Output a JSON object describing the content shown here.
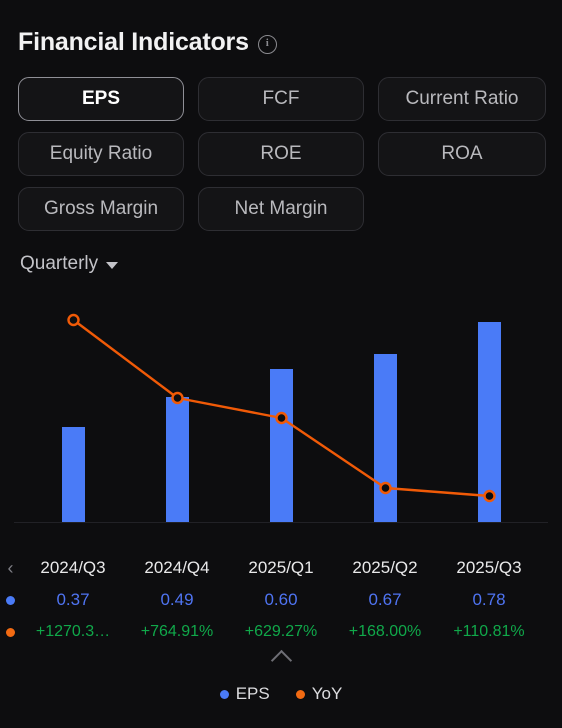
{
  "header": {
    "title": "Financial Indicators",
    "info_icon": "info-icon",
    "info_glyph": "i"
  },
  "indicators": {
    "selected": "EPS",
    "items": [
      {
        "label": "EPS",
        "selected": true
      },
      {
        "label": "FCF",
        "selected": false
      },
      {
        "label": "Current Ratio",
        "selected": false
      },
      {
        "label": "Equity Ratio",
        "selected": false
      },
      {
        "label": "ROE",
        "selected": false
      },
      {
        "label": "ROA",
        "selected": false
      },
      {
        "label": "Gross Margin",
        "selected": false
      },
      {
        "label": "Net Margin",
        "selected": false
      }
    ]
  },
  "period_selector": {
    "value": "Quarterly",
    "icon": "chevron-down-icon"
  },
  "table": {
    "prev_arrow": "‹",
    "eps_marker": "eps-legend-dot",
    "yoy_marker": "yoy-legend-dot",
    "periods": [
      "2024/Q3",
      "2024/Q4",
      "2025/Q1",
      "2025/Q2",
      "2025/Q3"
    ],
    "eps_values": [
      "0.37",
      "0.49",
      "0.60",
      "0.67",
      "0.78"
    ],
    "yoy_values": [
      "+1270.3…",
      "+764.91%",
      "+629.27%",
      "+168.00%",
      "+110.81%"
    ]
  },
  "collapse": {
    "icon": "chevron-up-icon"
  },
  "legend": {
    "items": [
      {
        "label": "EPS",
        "color": "#4a7bf7"
      },
      {
        "label": "YoY",
        "color": "#f26a12"
      }
    ]
  },
  "colors": {
    "background": "#0d0d0f",
    "bar": "#4a7bf7",
    "line": "#f05a07",
    "eps_text": "#4f74f2",
    "yoy_text": "#10a84a",
    "chip_border": "#2e2e33",
    "chip_border_selected": "#8f8f96"
  },
  "chart_data": {
    "type": "bar",
    "title": "Financial Indicators",
    "subtitle": "EPS",
    "xlabel": "",
    "ylabel": "",
    "grid": false,
    "legend_position": "bottom",
    "categories": [
      "2024/Q3",
      "2024/Q4",
      "2025/Q1",
      "2025/Q2",
      "2025/Q3"
    ],
    "series": [
      {
        "name": "EPS",
        "type": "bar",
        "color": "#4a7bf7",
        "values": [
          0.37,
          0.49,
          0.6,
          0.67,
          0.78
        ],
        "ylim": [
          0,
          0.95
        ]
      },
      {
        "name": "YoY",
        "type": "line",
        "color": "#f05a07",
        "values": [
          1270.3,
          764.91,
          629.27,
          168.0,
          110.81
        ],
        "value_labels": [
          "+1270.3…",
          "+764.91%",
          "+629.27%",
          "+168.00%",
          "+110.81%"
        ],
        "ylim": [
          0,
          1420
        ]
      }
    ]
  }
}
